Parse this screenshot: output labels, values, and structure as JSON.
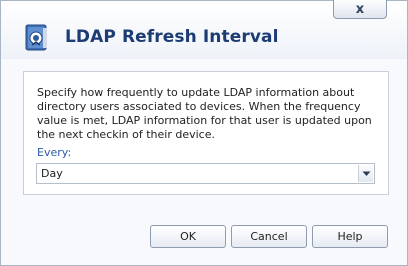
{
  "dialog": {
    "title": "LDAP Refresh Interval",
    "close_label": "x",
    "description": "Specify how frequently to update LDAP information about directory users associated to devices. When the frequency value is met, LDAP information for that user is updated upon the next checkin of their device.",
    "frequency_label": "Every:",
    "frequency_value": "Day",
    "buttons": {
      "ok": "OK",
      "cancel": "Cancel",
      "help": "Help"
    },
    "icons": {
      "app": "ldap-directory-icon",
      "dropdown": "chevron-down-icon"
    }
  }
}
